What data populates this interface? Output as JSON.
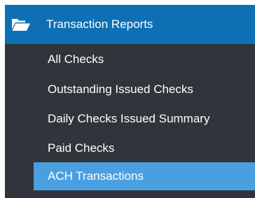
{
  "section": {
    "title": "Transaction Reports",
    "icon": "folder-open-icon"
  },
  "menu": {
    "items": [
      {
        "label": "All Checks",
        "active": false
      },
      {
        "label": "Outstanding Issued Checks",
        "active": false
      },
      {
        "label": "Daily Checks Issued Summary",
        "active": false
      },
      {
        "label": "Paid Checks",
        "active": false
      },
      {
        "label": "ACH Transactions",
        "active": true
      }
    ]
  },
  "colors": {
    "header_bg": "#0f6fb4",
    "panel_bg": "#2f353b",
    "active_bg": "#4a9fe0",
    "text": "#ffffff"
  }
}
